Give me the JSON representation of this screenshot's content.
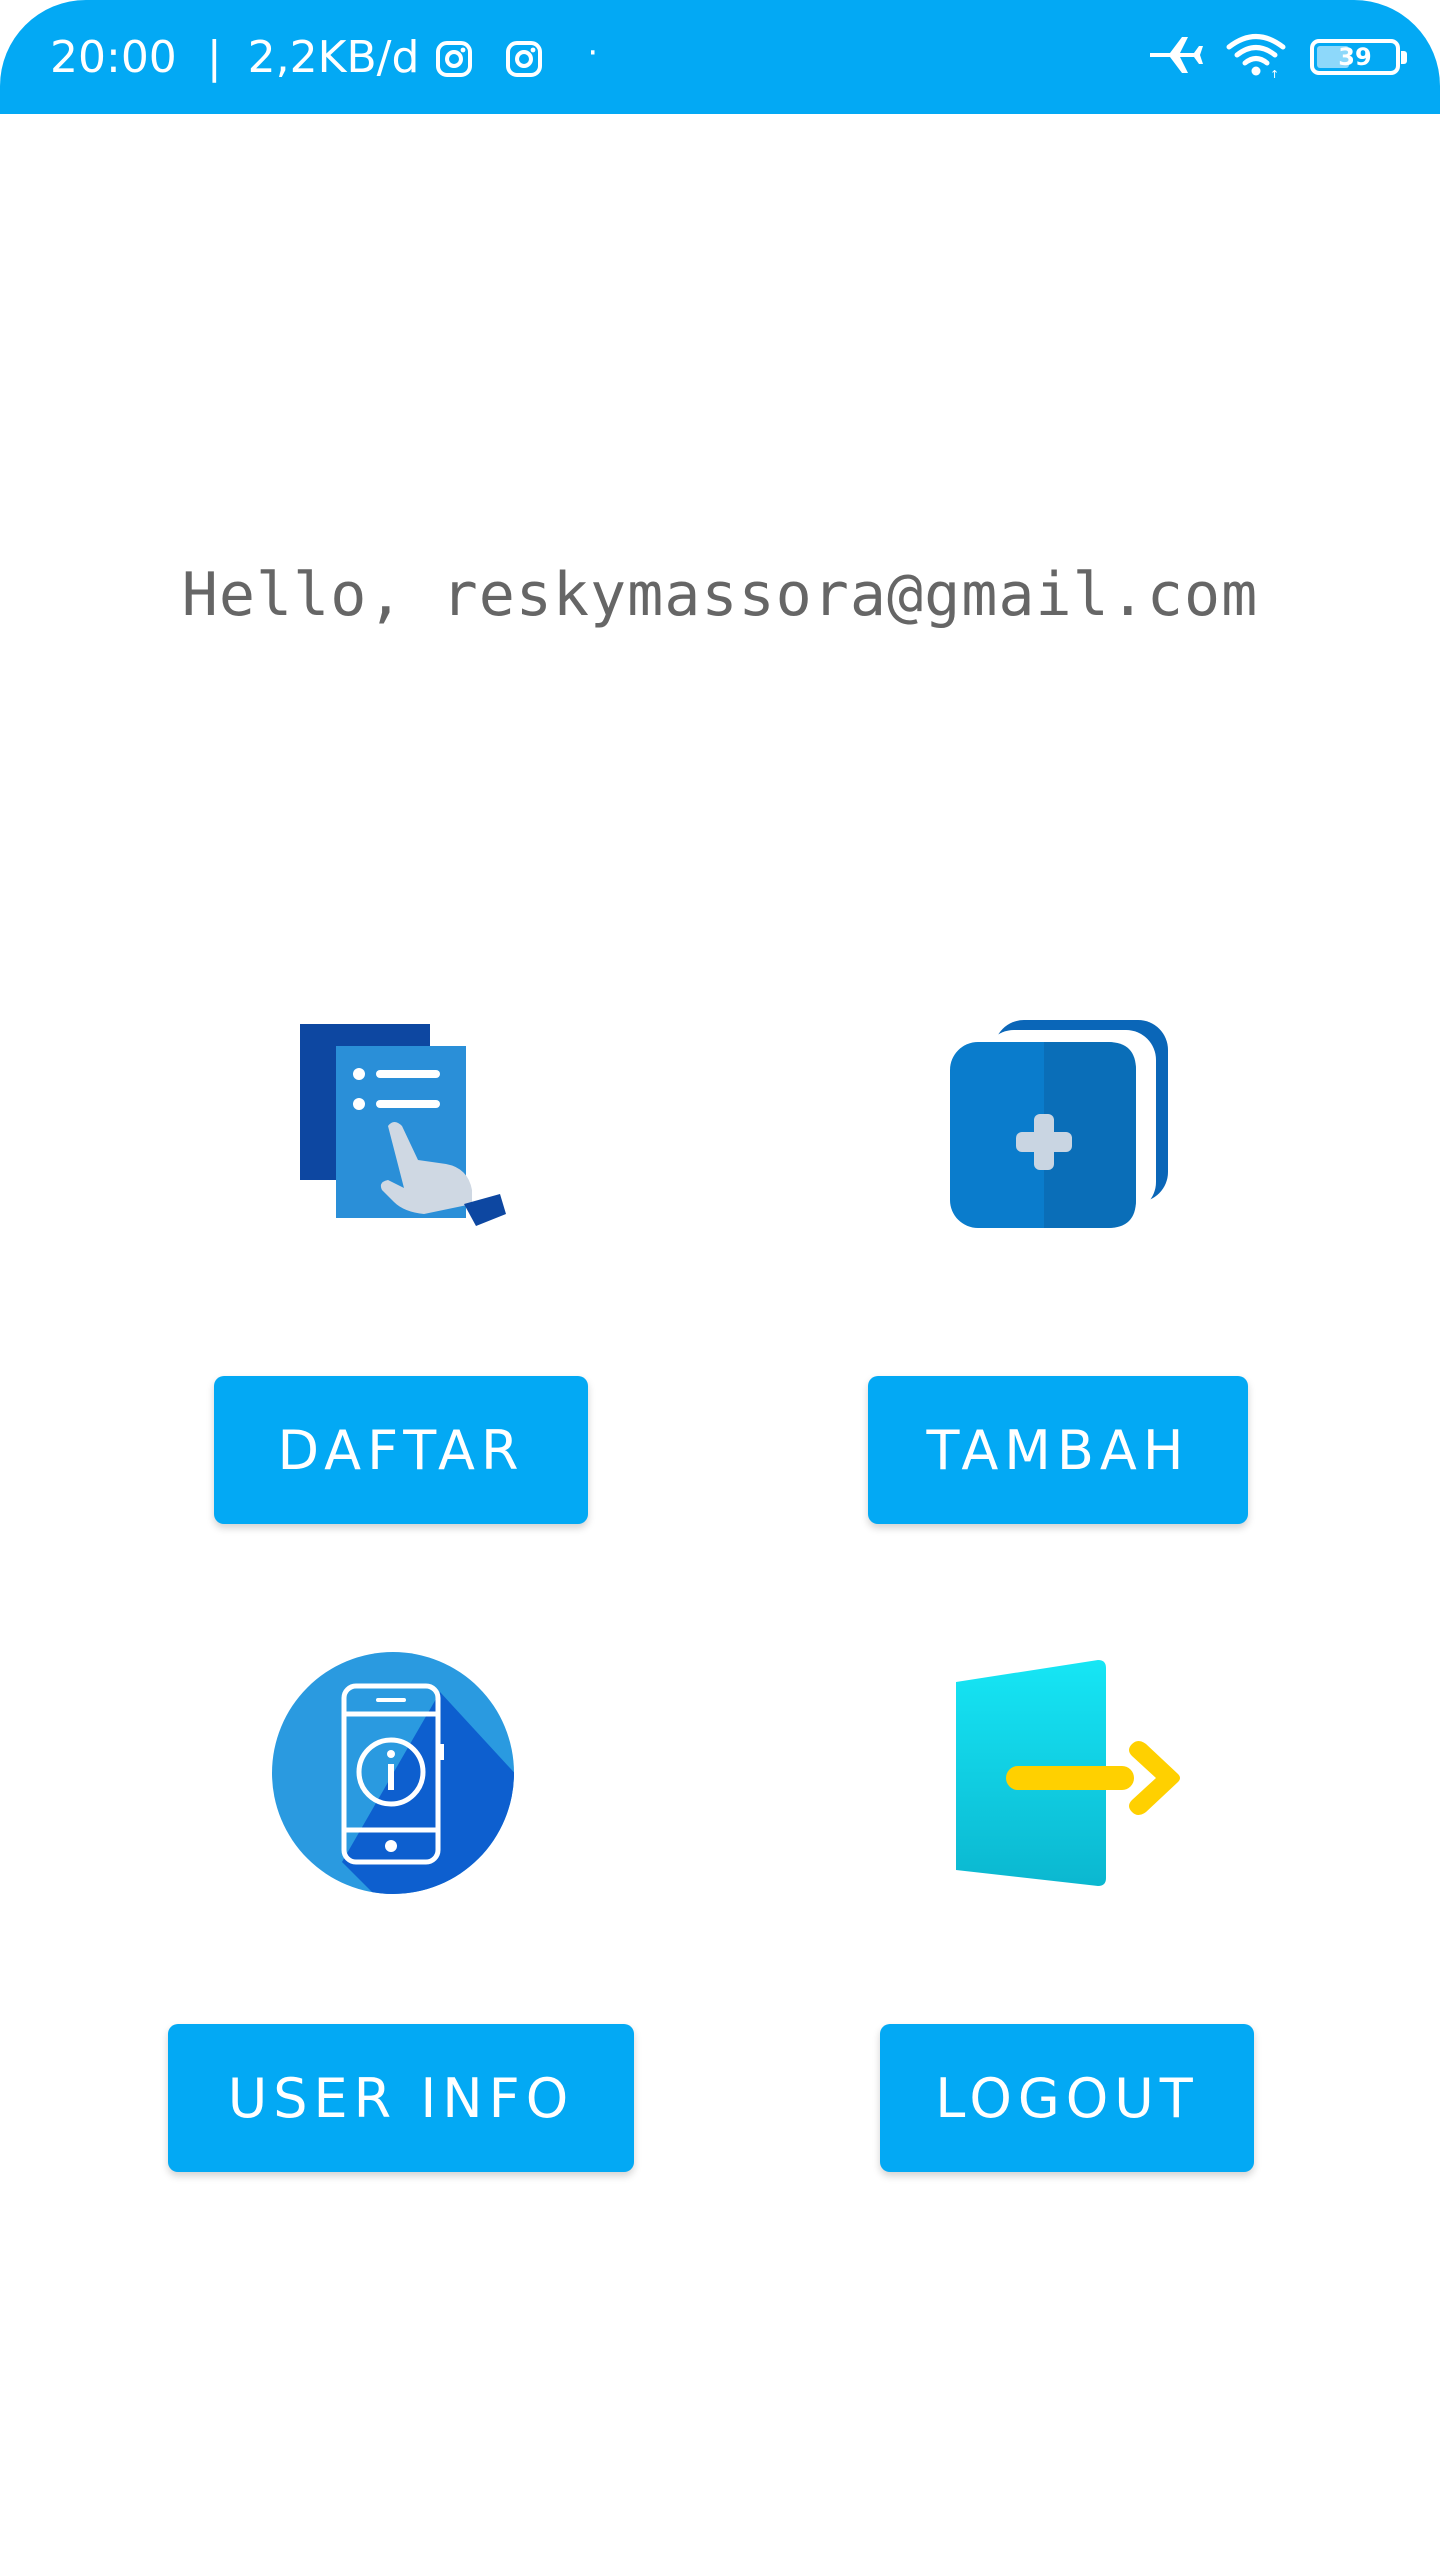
{
  "status_bar": {
    "time": "20:00",
    "separator": "|",
    "network_speed": "2,2KB/d",
    "notification_icons": [
      "instagram-icon",
      "instagram-icon"
    ],
    "dot": "·",
    "right_icons": [
      "airplane-mode-icon",
      "wifi-icon",
      "battery-icon"
    ],
    "battery_level": "39",
    "color": "#03a9f4"
  },
  "greeting": {
    "text": "Hello, reskymassora@gmail.com"
  },
  "menu": {
    "daftar": {
      "icon": "document-list-hand-icon",
      "label": "DAFTAR"
    },
    "tambah": {
      "icon": "add-copy-icon",
      "label": "TAMBAH"
    },
    "user_info": {
      "icon": "phone-info-icon",
      "label": "USER INFO"
    },
    "logout": {
      "icon": "logout-door-arrow-icon",
      "label": "LOGOUT"
    }
  },
  "colors": {
    "accent": "#03a9f4",
    "greeting_text": "#666666"
  }
}
